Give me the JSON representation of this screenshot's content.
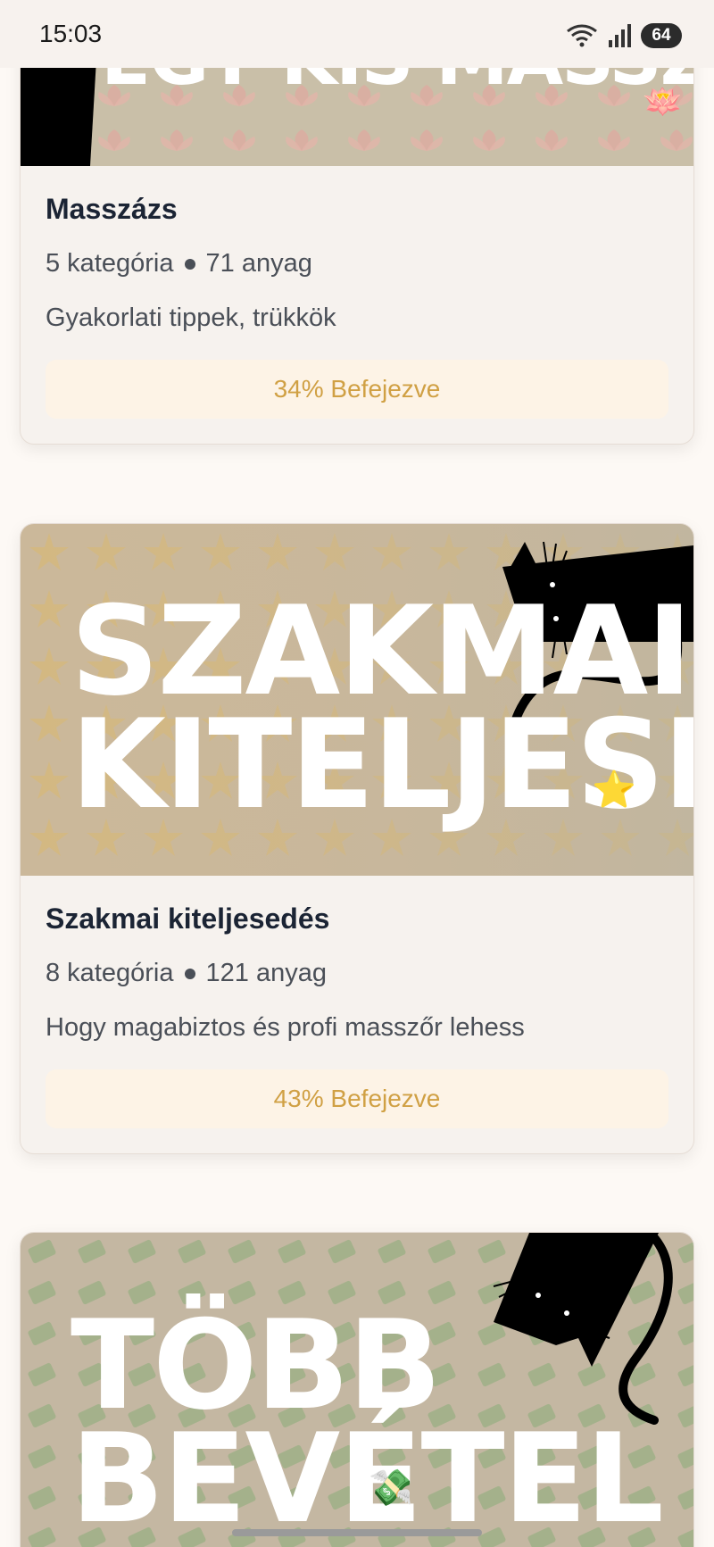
{
  "status_bar": {
    "time": "15:03",
    "battery": "64"
  },
  "courses": [
    {
      "banner_text": "EGY KIS MASSZÁZS",
      "title": "Masszázs",
      "categories": "5 kategória",
      "materials": "71 anyag",
      "description": "Gyakorlati tippek, trükkök",
      "progress": "34% Befejezve",
      "progress_value": 34
    },
    {
      "banner_line1": "SZAKMAI",
      "banner_line2": "KITELJESEDÉS",
      "title": "Szakmai kiteljesedés",
      "categories": "8 kategória",
      "materials": "121 anyag",
      "description": "Hogy magabiztos és profi masszőr lehess",
      "progress": "43% Befejezve",
      "progress_value": 43
    },
    {
      "banner_line1": "TÖBB",
      "banner_line2": "BEVÉTEL"
    }
  ],
  "icons": {
    "wifi": "wifi-icon",
    "signal": "signal-icon",
    "battery": "battery-icon",
    "cat": "cat-illustration",
    "star": "star-icon",
    "money": "money-icon",
    "lotus": "lotus-icon"
  },
  "colors": {
    "progress_text": "#d0a044",
    "progress_bg": "#fdf3e6",
    "title": "#1b2434"
  }
}
